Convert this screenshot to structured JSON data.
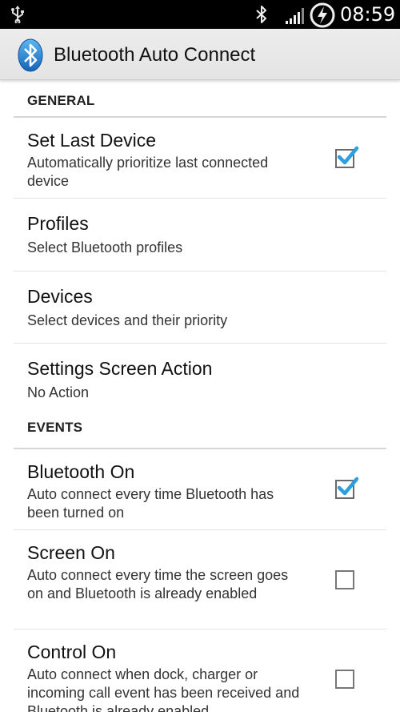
{
  "status_bar": {
    "time": "08:59",
    "icons": [
      "usb-icon",
      "bluetooth-icon",
      "signal-icon",
      "battery-charging-icon"
    ]
  },
  "action_bar": {
    "title": "Bluetooth Auto Connect",
    "icon": "bluetooth-app-icon",
    "accent": "#1f7fd6"
  },
  "sections": {
    "general": {
      "header": "GENERAL",
      "items": [
        {
          "title": "Set Last Device",
          "summary": "Automatically prioritize last connected device",
          "checked": true
        },
        {
          "title": "Profiles",
          "summary": "Select Bluetooth profiles"
        },
        {
          "title": "Devices",
          "summary": "Select devices and their priority"
        },
        {
          "title": "Settings Screen Action",
          "summary": "No Action"
        }
      ]
    },
    "events": {
      "header": "EVENTS",
      "items": [
        {
          "title": "Bluetooth On",
          "summary": "Auto connect every time Bluetooth has been turned on",
          "checked": true
        },
        {
          "title": "Screen On",
          "summary": "Auto connect every time the screen goes on and Bluetooth is already enabled",
          "checked": false
        },
        {
          "title": "Control On",
          "summary": "Auto connect when dock, charger or incoming call event has been received and Bluetooth is already enabled",
          "checked": false
        }
      ]
    }
  },
  "colors": {
    "checkmark": "#2b9fe0",
    "section_divider": "#d6d6d6"
  }
}
